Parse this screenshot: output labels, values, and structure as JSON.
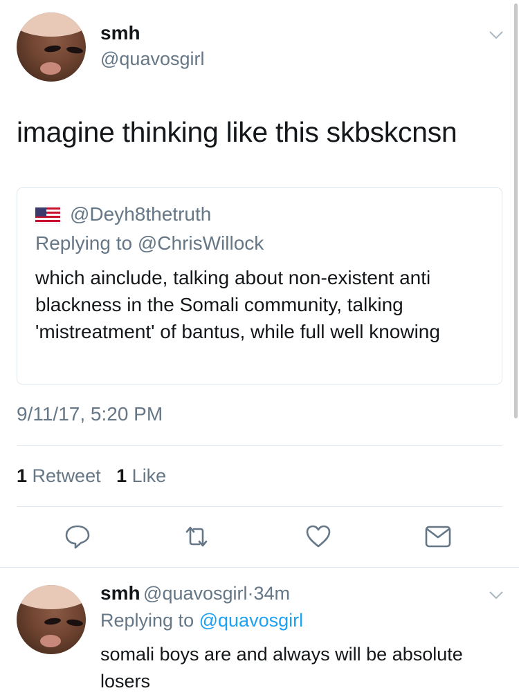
{
  "main_tweet": {
    "display_name": "smh",
    "handle": "@quavosgirl",
    "text": "imagine thinking like this skbskcnsn",
    "quoted": {
      "handle": "@Deyh8thetruth",
      "replying_to": "Replying to @ChrisWillock",
      "body": "which ainclude, talking about non-existent anti blackness in the Somali community, talking 'mistreatment' of bantus, while full well knowing"
    },
    "timestamp": "9/11/17, 5:20 PM",
    "retweet_count": "1",
    "retweet_label": "Retweet",
    "like_count": "1",
    "like_label": "Like"
  },
  "reply_tweet": {
    "display_name": "smh",
    "handle": "@quavosgirl",
    "separator": "·",
    "age": "34m",
    "replying_prefix": "Replying to",
    "replying_handle": "@quavosgirl",
    "text": "somali boys are and always will be absolute losers"
  },
  "colors": {
    "secondary": "#657786",
    "link": "#1da1f2",
    "border": "#e1e8ed"
  },
  "icons": [
    "chevron-down-icon",
    "us-flag-icon",
    "reply-icon",
    "retweet-icon",
    "like-icon",
    "direct-message-icon"
  ]
}
